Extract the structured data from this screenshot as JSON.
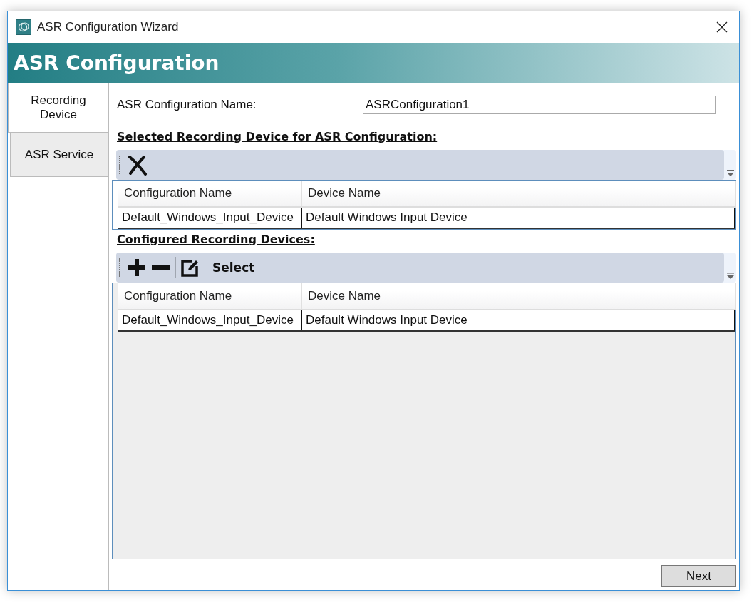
{
  "window": {
    "title": "ASR Configuration Wizard"
  },
  "header": {
    "title": "ASR Configuration"
  },
  "tabs": [
    {
      "label": "Recording Device",
      "selected": true
    },
    {
      "label": "ASR Service",
      "selected": false
    }
  ],
  "name_field": {
    "label": "ASR Configuration Name:",
    "value": "ASRConfiguration1"
  },
  "selected_section": {
    "title": "Selected Recording Device for ASR Configuration:",
    "toolbar": [
      {
        "kind": "remove"
      }
    ],
    "columns": [
      "Configuration Name",
      "Device Name"
    ],
    "rows": [
      [
        "Default_Windows_Input_Device",
        "Default Windows Input Device"
      ]
    ]
  },
  "configured_section": {
    "title": "Configured Recording Devices:",
    "toolbar": [
      {
        "kind": "add"
      },
      {
        "kind": "minus"
      },
      {
        "kind": "separator"
      },
      {
        "kind": "edit"
      },
      {
        "kind": "separator"
      },
      {
        "kind": "text",
        "label": "Select"
      }
    ],
    "columns": [
      "Configuration Name",
      "Device Name"
    ],
    "rows": [
      [
        "Default_Windows_Input_Device",
        "Default Windows Input Device"
      ]
    ]
  },
  "buttons": [
    "Next"
  ]
}
